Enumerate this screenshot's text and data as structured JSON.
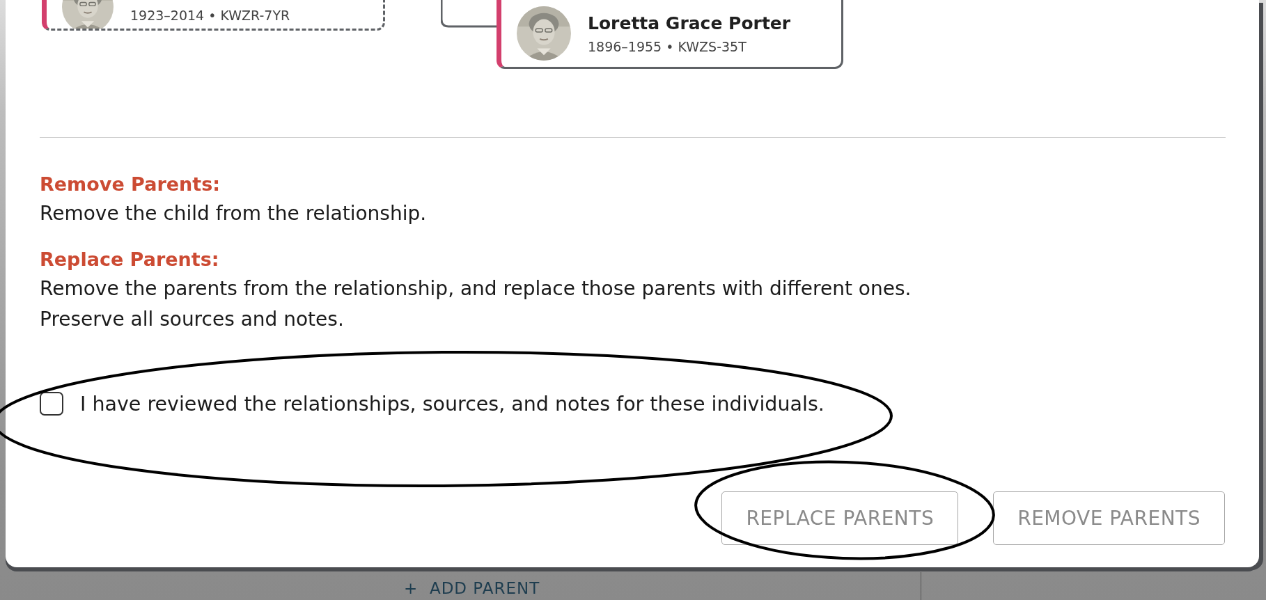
{
  "family_cards": [
    {
      "details": "1923–2014 • KWZR-7YR"
    },
    {
      "name": "Loretta Grace Porter",
      "details": "1896–1955 • KWZS-35T"
    }
  ],
  "options": [
    {
      "title": "Remove Parents:",
      "lines": [
        "Remove the child from the relationship."
      ]
    },
    {
      "title": "Replace Parents:",
      "lines": [
        "Remove the parents from the relationship, and replace those parents with different ones.",
        "Preserve all sources and notes."
      ]
    }
  ],
  "confirmation": {
    "label": "I have reviewed the relationships, sources, and notes for these individuals.",
    "checked": false
  },
  "buttons": [
    {
      "label": "REPLACE PARENTS",
      "disabled": true
    },
    {
      "label": "REMOVE PARENTS",
      "disabled": true
    }
  ],
  "background_link": {
    "label": "+  ADD PARENT"
  },
  "annotations": [
    {
      "kind": "ellipse"
    },
    {
      "kind": "ellipse"
    }
  ]
}
